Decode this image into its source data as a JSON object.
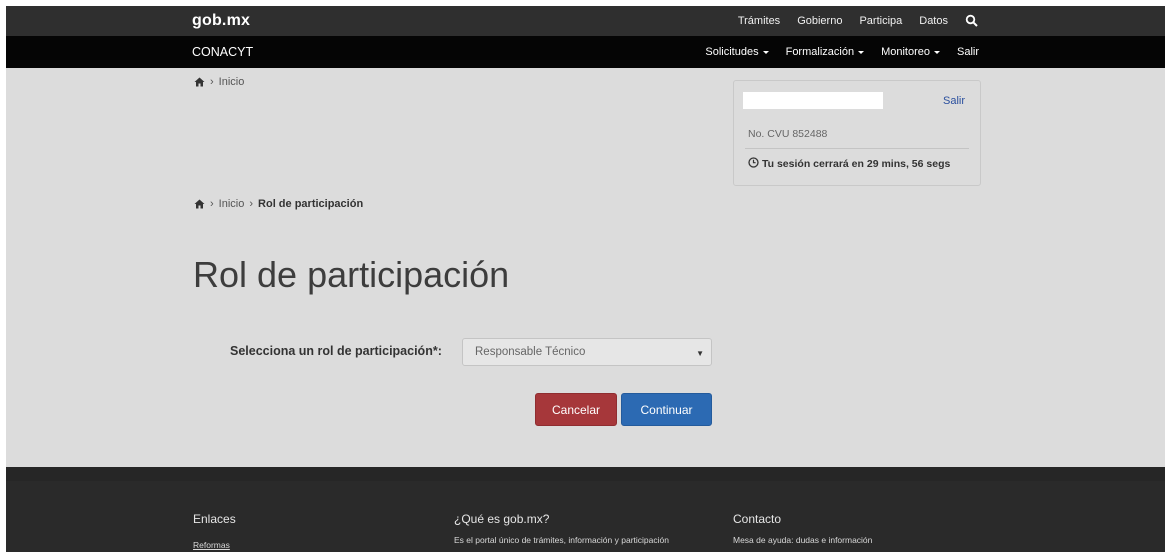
{
  "topbar": {
    "logo": "gob.mx",
    "links": [
      "Trámites",
      "Gobierno",
      "Participa",
      "Datos"
    ],
    "search_icon": "search-icon"
  },
  "subbar": {
    "title": "CONACYT",
    "menu": [
      {
        "label": "Solicitudes",
        "dropdown": true
      },
      {
        "label": "Formalización",
        "dropdown": true
      },
      {
        "label": "Monitoreo",
        "dropdown": true
      },
      {
        "label": "Salir",
        "dropdown": false
      }
    ]
  },
  "breadcrumb_top": {
    "home_icon": "home-icon",
    "separator": "›",
    "inicio": "Inicio"
  },
  "user_panel": {
    "salir": "Salir",
    "cvu": "No. CVU 852488",
    "session": "Tu sesión cerrará en 29 mins, 56 segs",
    "clock_icon": "clock-icon"
  },
  "breadcrumb_main": {
    "separator": "›",
    "inicio": "Inicio",
    "current": "Rol de participación"
  },
  "page": {
    "title": "Rol de participación"
  },
  "form": {
    "label": "Selecciona un rol de participación*:",
    "selected": "Responsable Técnico",
    "cancel": "Cancelar",
    "continue": "Continuar"
  },
  "footer": {
    "col1": {
      "title": "Enlaces",
      "text": "Reformas"
    },
    "col2": {
      "title": "¿Qué es gob.mx?",
      "text": "Es el portal único de trámites, información y participación"
    },
    "col3": {
      "title": "Contacto",
      "text": "Mesa de ayuda: dudas e información"
    }
  },
  "colors": {
    "cancel": "#a6373a",
    "continue": "#2c6ab3",
    "navbar": "#050505",
    "topbar": "#2f2f2f",
    "link": "#2a4f9e"
  }
}
